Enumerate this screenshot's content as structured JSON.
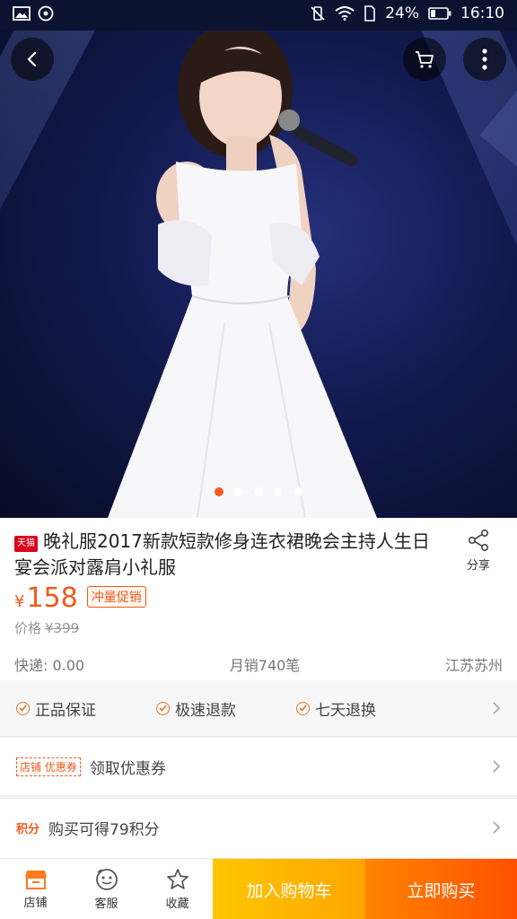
{
  "status_bar": {
    "battery": "24%",
    "time": "16:10"
  },
  "hero": {
    "carousel_total": 5,
    "carousel_active": 1
  },
  "product": {
    "store_badge": "天猫",
    "title": "晚礼服2017新款短款修身连衣裙晚会主持人生日宴会派对露肩小礼服",
    "share_label": "分享",
    "currency": "¥",
    "price": "158",
    "promo_tag": "冲量促销",
    "original_price_label": "价格",
    "original_price": "¥399",
    "shipping": "快递: 0.00",
    "monthly_sales": "月销740笔",
    "location": "江苏苏州"
  },
  "services": {
    "items": [
      "正品保证",
      "极速退款",
      "七天退换"
    ]
  },
  "coupon": {
    "tag": "店铺 优惠券",
    "label": "领取优惠券"
  },
  "points": {
    "tag": "积分",
    "label": "购买可得79积分"
  },
  "bottom_bar": {
    "store_label": "店铺",
    "service_label": "客服",
    "favorite_label": "收藏",
    "add_to_cart_label": "加入购物车",
    "buy_now_label": "立即购买"
  },
  "colors": {
    "accent": "#f05a1a",
    "cart_button": "#ffb300",
    "buy_button": "#ff5a00"
  }
}
